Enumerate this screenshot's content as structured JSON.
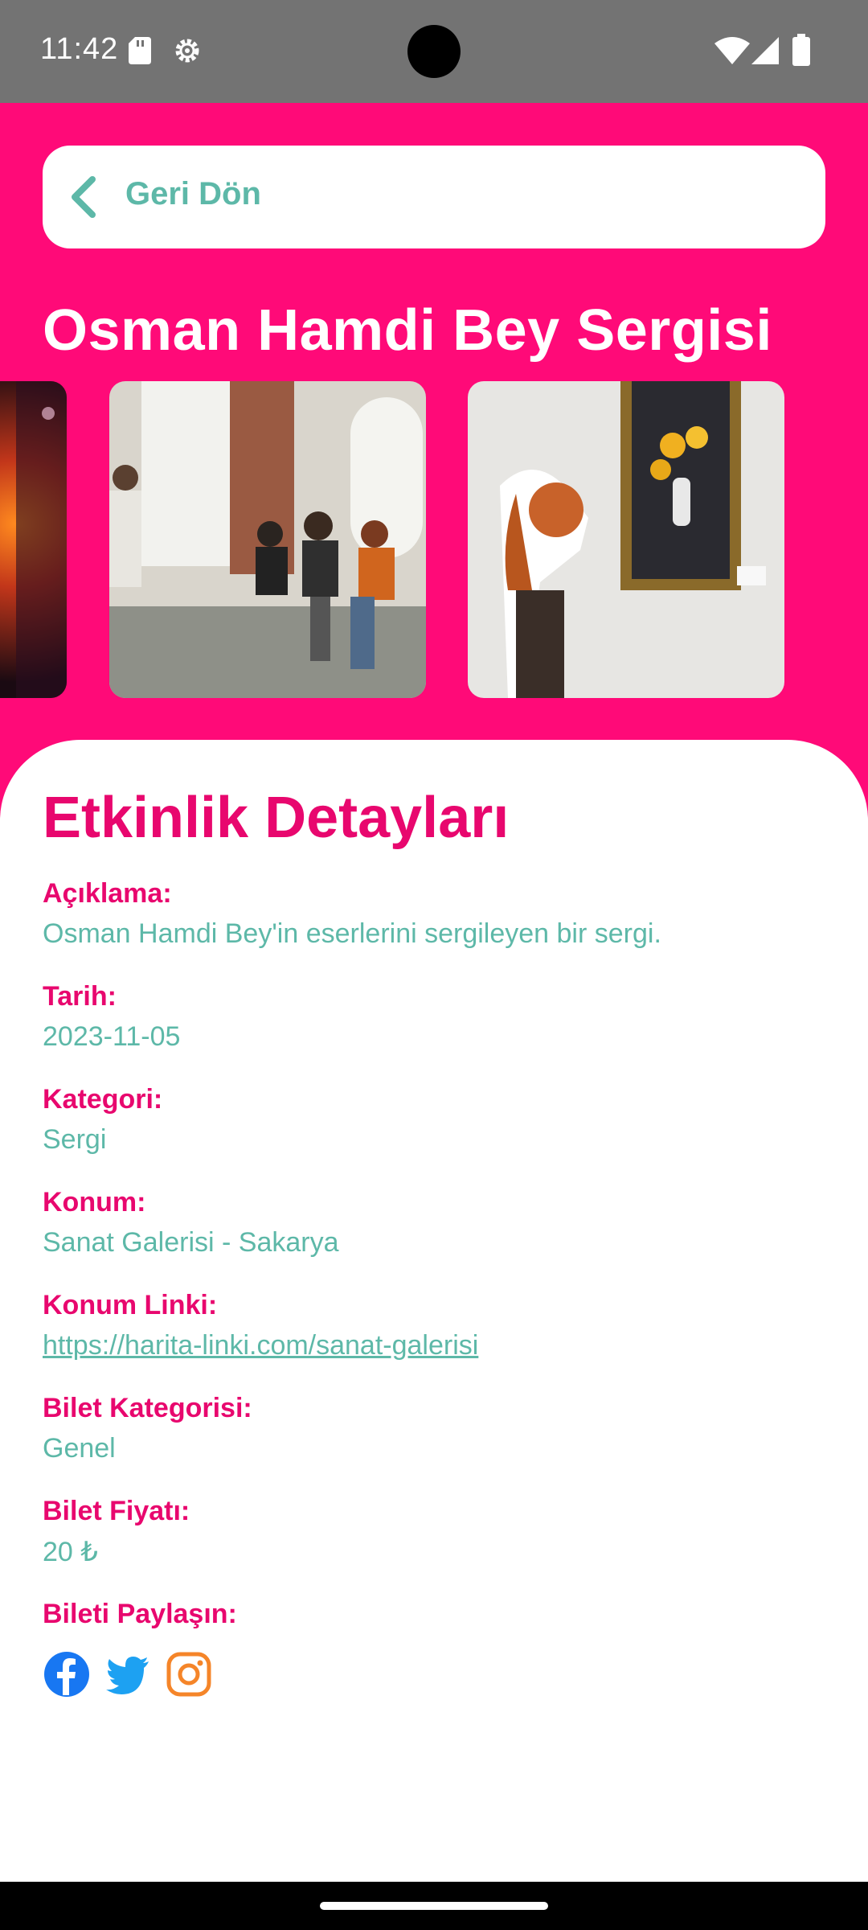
{
  "status_bar": {
    "time": "11:42",
    "icons": [
      "sd-card-icon",
      "gear-icon",
      "wifi-icon",
      "signal-icon",
      "battery-icon"
    ]
  },
  "header": {
    "back_label": "Geri Dön",
    "title": "Osman Hamdi Bey Sergisi"
  },
  "gallery": {
    "images": [
      "stage-lights-photo",
      "audience-seminar-photo",
      "woman-viewing-painting-photo"
    ]
  },
  "details": {
    "title": "Etkinlik Detayları",
    "fields": [
      {
        "label": "Açıklama:",
        "value": "Osman Hamdi Bey'in eserlerini sergileyen bir sergi."
      },
      {
        "label": "Tarih:",
        "value": "2023-11-05"
      },
      {
        "label": "Kategori:",
        "value": "Sergi"
      },
      {
        "label": "Konum:",
        "value": "Sanat Galerisi - Sakarya"
      },
      {
        "label": "Konum Linki:",
        "value": "https://harita-linki.com/sanat-galerisi"
      },
      {
        "label": "Bilet Kategorisi:",
        "value": "Genel"
      },
      {
        "label": "Bilet Fiyatı:",
        "value": "20 ₺"
      }
    ],
    "share_label": "Bileti Paylaşın:",
    "share_icons": [
      "facebook-icon",
      "twitter-icon",
      "instagram-icon"
    ]
  },
  "colors": {
    "header_bg": "#FF0A78",
    "label": "#E8076E",
    "value": "#5DB8A8",
    "status_bar": "#737373",
    "facebook": "#1877F2",
    "twitter": "#1DA1F2",
    "instagram": "#F58529"
  }
}
